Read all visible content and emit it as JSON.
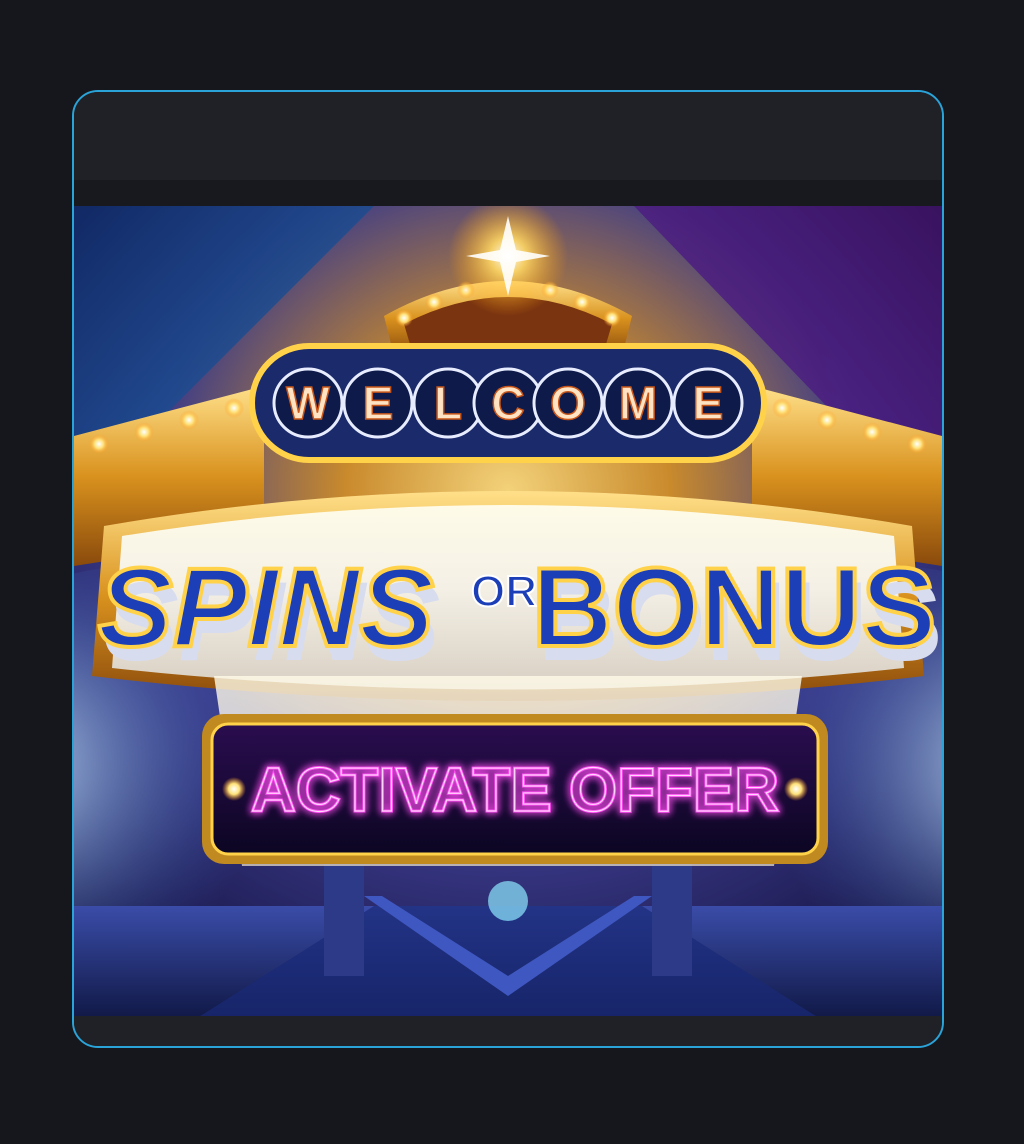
{
  "promo": {
    "welcome_letters": [
      "W",
      "E",
      "L",
      "C",
      "O",
      "M",
      "E"
    ],
    "spins_text": "SPINS",
    "or_text": "OR",
    "bonus_text": "BONUS",
    "cta_label": "ACTIVATE OFFER"
  },
  "colors": {
    "modal_border": "#2aa3d8",
    "modal_bg": "#202127",
    "page_bg": "#16171c",
    "headline_blue": "#1c3fb8",
    "neon_pink": "#ff4df2",
    "gold": "#f2b233"
  },
  "icons": {
    "marquee_light": "marquee-bulb-icon",
    "top_star": "starburst-icon"
  }
}
